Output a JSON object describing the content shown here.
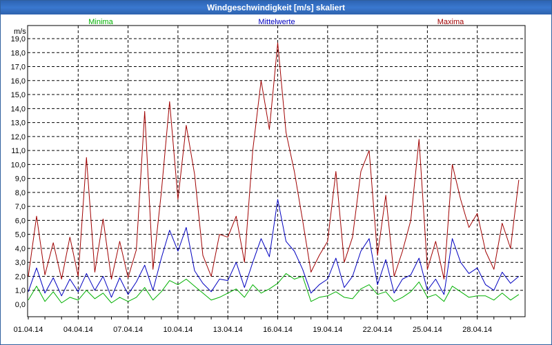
{
  "window": {
    "title": "Windgeschwindigkeit [m/s] skaliert"
  },
  "colors": {
    "min": "#00b000",
    "mean": "#0000c0",
    "max": "#a00000",
    "titlebar": "#3a78cf"
  },
  "chart_data": {
    "type": "line",
    "title": "Windgeschwindigkeit [m/s] skaliert",
    "ylabel": "m/s",
    "xlabel": "",
    "ylim": [
      0,
      19.5
    ],
    "grid": true,
    "y_ticks": [
      "0,0",
      "1,0",
      "2,0",
      "3,0",
      "4,0",
      "5,0",
      "6,0",
      "7,0",
      "8,0",
      "9,0",
      "10,0",
      "11,0",
      "12,0",
      "13,0",
      "14,0",
      "15,0",
      "16,0",
      "17,0",
      "18,0",
      "19,0"
    ],
    "x_ticks": [
      "01.04.14",
      "04.04.14",
      "07.04.14",
      "10.04.14",
      "13.04.14",
      "16.04.14",
      "19.04.14",
      "22.04.14",
      "25.04.14",
      "28.04.14"
    ],
    "x_range_days": [
      0,
      29.9
    ],
    "series": [
      {
        "name": "Minima",
        "color": "#00b000",
        "x": [
          0,
          0.5,
          1,
          1.5,
          2,
          2.5,
          3,
          3.5,
          4,
          4.5,
          5,
          5.5,
          6,
          6.5,
          7,
          7.5,
          8,
          8.5,
          9,
          9.5,
          10,
          10.5,
          11,
          11.5,
          12,
          12.5,
          13,
          13.5,
          14,
          14.5,
          15,
          15.5,
          16,
          16.5,
          17,
          17.5,
          18,
          18.5,
          19,
          19.5,
          20,
          20.5,
          21,
          21.5,
          22,
          22.5,
          23,
          23.5,
          24,
          24.5,
          25,
          25.5,
          26,
          26.5,
          27,
          27.5,
          28,
          28.5,
          29,
          29.5
        ],
        "values": [
          0.3,
          1.3,
          0.2,
          0.9,
          0.1,
          0.5,
          0.3,
          1.0,
          0.4,
          0.8,
          0.1,
          0.5,
          0.2,
          0.5,
          1.2,
          0.3,
          0.9,
          1.7,
          1.4,
          1.8,
          1.3,
          0.8,
          0.3,
          0.5,
          0.8,
          1.1,
          0.5,
          1.4,
          0.8,
          1.1,
          1.5,
          2.2,
          1.8,
          2.0,
          0.2,
          0.5,
          0.6,
          0.9,
          0.5,
          0.4,
          1.1,
          1.4,
          0.7,
          0.9,
          0.2,
          0.5,
          0.9,
          1.6,
          0.5,
          0.7,
          0.2,
          1.3,
          0.9,
          0.5,
          0.6,
          0.6,
          0.3,
          0.8,
          0.3,
          0.7
        ]
      },
      {
        "name": "Mittelwerte",
        "color": "#0000c0",
        "x": [
          0,
          0.5,
          1,
          1.5,
          2,
          2.5,
          3,
          3.5,
          4,
          4.5,
          5,
          5.5,
          6,
          6.5,
          7,
          7.5,
          8,
          8.5,
          9,
          9.5,
          10,
          10.5,
          11,
          11.5,
          12,
          12.5,
          13,
          13.5,
          14,
          14.5,
          15,
          15.5,
          16,
          16.5,
          17,
          17.5,
          18,
          18.5,
          19,
          19.5,
          20,
          20.5,
          21,
          21.5,
          22,
          22.5,
          23,
          23.5,
          24,
          24.5,
          25,
          25.5,
          26,
          26.5,
          27,
          27.5,
          28,
          28.5,
          29,
          29.5
        ],
        "values": [
          0.9,
          2.6,
          0.8,
          1.9,
          0.6,
          1.8,
          0.9,
          2.2,
          1.0,
          2.0,
          0.5,
          1.9,
          0.7,
          1.6,
          2.8,
          1.0,
          3.3,
          5.3,
          3.8,
          5.5,
          2.4,
          1.5,
          0.9,
          1.8,
          1.7,
          3.0,
          1.2,
          3.0,
          4.7,
          3.4,
          7.5,
          4.5,
          3.8,
          2.5,
          0.8,
          1.4,
          1.8,
          3.3,
          1.2,
          2.0,
          3.8,
          4.7,
          1.4,
          3.2,
          0.8,
          1.8,
          2.1,
          3.3,
          1.0,
          1.8,
          0.7,
          4.7,
          3.0,
          2.2,
          2.6,
          1.4,
          1.0,
          2.3,
          1.5,
          2.0
        ]
      },
      {
        "name": "Maxima",
        "color": "#a00000",
        "x": [
          0,
          0.5,
          1,
          1.5,
          2,
          2.5,
          3,
          3.5,
          4,
          4.5,
          5,
          5.5,
          6,
          6.5,
          7,
          7.5,
          8,
          8.5,
          9,
          9.5,
          10,
          10.5,
          11,
          11.5,
          12,
          12.5,
          13,
          13.5,
          14,
          14.5,
          15,
          15.5,
          16,
          16.5,
          17,
          17.5,
          18,
          18.5,
          19,
          19.5,
          20,
          20.5,
          21,
          21.5,
          22,
          22.5,
          23,
          23.5,
          24,
          24.5,
          25,
          25.5,
          26,
          26.5,
          27,
          27.5,
          28,
          28.5,
          29,
          29.5
        ],
        "values": [
          2.0,
          6.3,
          2.1,
          4.4,
          1.8,
          4.8,
          2.0,
          10.5,
          2.3,
          6.1,
          1.8,
          4.5,
          1.9,
          3.9,
          13.8,
          2.5,
          8.0,
          14.5,
          7.5,
          12.8,
          9.3,
          3.5,
          2.0,
          5.0,
          4.8,
          6.3,
          3.0,
          11.0,
          16.0,
          12.5,
          18.7,
          12.3,
          9.5,
          6.0,
          2.3,
          3.5,
          4.5,
          9.5,
          3.0,
          4.8,
          9.5,
          11.0,
          3.5,
          7.8,
          2.0,
          3.8,
          6.0,
          11.8,
          2.5,
          4.5,
          1.8,
          10.0,
          7.5,
          5.5,
          6.5,
          3.8,
          2.5,
          5.8,
          4.0,
          8.9
        ]
      }
    ]
  }
}
